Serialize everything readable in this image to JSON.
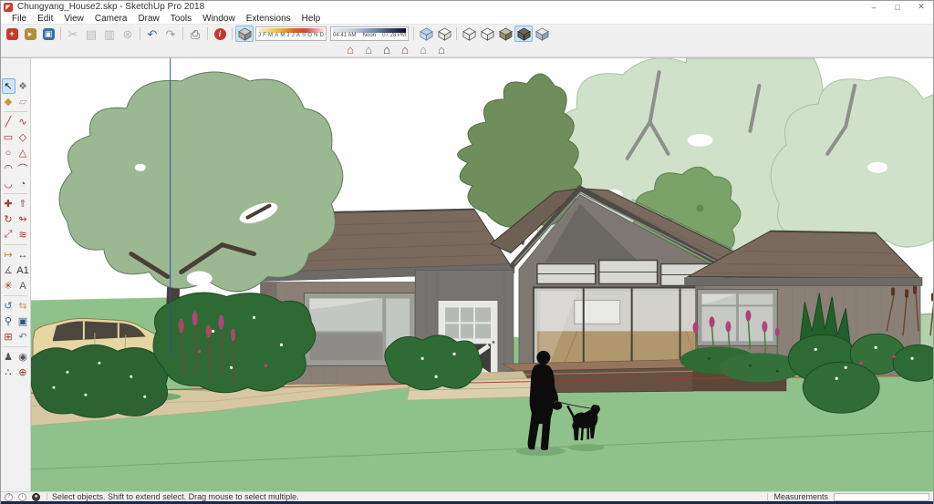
{
  "window": {
    "title": "Chungyang_House2.skp - SketchUp Pro 2018",
    "logo_glyph": "◤",
    "controls": [
      {
        "name": "minimize-button",
        "glyph": "–"
      },
      {
        "name": "maximize-button",
        "glyph": "□"
      },
      {
        "name": "close-button",
        "glyph": "✕"
      }
    ]
  },
  "menu_bar": {
    "items": [
      "File",
      "Edit",
      "View",
      "Camera",
      "Draw",
      "Tools",
      "Window",
      "Extensions",
      "Help"
    ]
  },
  "toolbar": {
    "standard": [
      {
        "name": "new",
        "glyph": "+",
        "chip": "#c23b2e"
      },
      {
        "name": "open",
        "glyph": "▸",
        "chip": "#b08f3e"
      },
      {
        "name": "save",
        "glyph": "▣",
        "chip": "#3a6ea5"
      },
      {
        "sep": true
      },
      {
        "name": "cut",
        "glyph": "✂",
        "disabled": true
      },
      {
        "name": "copy",
        "glyph": "▤",
        "disabled": true
      },
      {
        "name": "paste",
        "glyph": "▥",
        "disabled": true
      },
      {
        "name": "erase",
        "glyph": "⊗",
        "disabled": true
      },
      {
        "sep": true
      },
      {
        "name": "undo",
        "glyph": "↶",
        "color": "#3a6ea5"
      },
      {
        "name": "redo",
        "glyph": "↷",
        "color": "#98a0a8"
      },
      {
        "sep": true
      },
      {
        "name": "print",
        "glyph": "⎙",
        "color": "#555555"
      },
      {
        "sep": true
      },
      {
        "name": "model-info",
        "glyph": "i",
        "chip": "#c23b2e",
        "round": true
      },
      {
        "sep": true
      }
    ],
    "shadow": {
      "toggle_name": "shadows-toggle",
      "months": [
        "J",
        "F",
        "M",
        "A",
        "M",
        "J",
        "J",
        "A",
        "S",
        "O",
        "N",
        "D"
      ],
      "time_start": "04:41 AM",
      "time_mid": "Noon",
      "time_end": "07:28 PM"
    },
    "styles": {
      "buttons": [
        "x-ray",
        "back-edges",
        "wireframe",
        "hidden-line",
        "shaded",
        "shaded-with-textures",
        "monochrome"
      ],
      "active": "shaded-with-textures",
      "group_break_after": "back-edges"
    },
    "views": [
      {
        "name": "iso",
        "glyph": "⌂",
        "color": "#b0502f"
      },
      {
        "name": "top",
        "glyph": "⌂",
        "color": "#6b7c8c"
      },
      {
        "name": "front",
        "glyph": "⌂",
        "color": "#2f3a44"
      },
      {
        "name": "right",
        "glyph": "⌂",
        "color": "#7c4a3a"
      },
      {
        "name": "back",
        "glyph": "⌂",
        "color": "#8a8a8a"
      },
      {
        "name": "left",
        "glyph": "⌂",
        "color": "#5a6b5a"
      }
    ]
  },
  "tool_palette": {
    "active": "select",
    "dividers_after_row": [
      2,
      7,
      10,
      13,
      16
    ],
    "rows": [
      [
        "select",
        "make-component"
      ],
      [
        "paint-bucket",
        "eraser"
      ],
      [
        "line",
        "freehand"
      ],
      [
        "rectangle",
        "rotated-rectangle"
      ],
      [
        "circle",
        "polygon"
      ],
      [
        "arc",
        "2-point-arc"
      ],
      [
        "3-point-arc",
        "pie"
      ],
      [
        "move",
        "push-pull"
      ],
      [
        "rotate",
        "follow-me"
      ],
      [
        "scale",
        "offset"
      ],
      [
        "tape-measure",
        "dimension"
      ],
      [
        "protractor",
        "text"
      ],
      [
        "axes",
        "3d-text"
      ],
      [
        "orbit",
        "pan"
      ],
      [
        "zoom",
        "zoom-window"
      ],
      [
        "zoom-extents",
        "previous-view"
      ],
      [
        "position-camera",
        "look-around"
      ],
      [
        "walk",
        "section-plane"
      ]
    ],
    "icons": {
      "select": "↖",
      "make-component": "❖",
      "paint-bucket": "◆",
      "eraser": "▱",
      "line": "╱",
      "freehand": "∿",
      "rectangle": "▭",
      "rotated-rectangle": "◇",
      "circle": "○",
      "polygon": "△",
      "arc": "◠",
      "2-point-arc": "⌒",
      "3-point-arc": "◡",
      "pie": "◔",
      "move": "✚",
      "push-pull": "⇑",
      "rotate": "↻",
      "follow-me": "↬",
      "scale": "⤢",
      "offset": "≋",
      "tape-measure": "↦",
      "dimension": "↔",
      "protractor": "∡",
      "text": "A1",
      "axes": "✳",
      "3d-text": "A",
      "orbit": "↺",
      "pan": "⇆",
      "zoom": "⚲",
      "zoom-window": "▣",
      "zoom-extents": "⊞",
      "previous-view": "↶",
      "position-camera": "♟",
      "look-around": "◉",
      "walk": "∴",
      "section-plane": "⊕"
    },
    "icon_colors": {
      "select": "#1a1a1a",
      "make-component": "#7d7d7d",
      "paint-bucket": "#c59b2d",
      "eraser": "#cf8ca0",
      "line": "#a33b2e",
      "freehand": "#a33b2e",
      "rectangle": "#a33b2e",
      "rotated-rectangle": "#a33b2e",
      "circle": "#a33b2e",
      "polygon": "#a33b2e",
      "arc": "#a33b2e",
      "2-point-arc": "#a33b2e",
      "3-point-arc": "#a33b2e",
      "pie": "#a33b2e",
      "move": "#a33b2e",
      "push-pull": "#8a5a4a",
      "rotate": "#a33b2e",
      "follow-me": "#a33b2e",
      "scale": "#a33b2e",
      "offset": "#a33b2e",
      "tape-measure": "#b8860b",
      "dimension": "#555555",
      "protractor": "#777777",
      "text": "#333333",
      "axes": "#a33b2e",
      "3d-text": "#555555",
      "orbit": "#3a6ea5",
      "pan": "#c49a6c",
      "zoom": "#345577",
      "zoom-window": "#345577",
      "zoom-extents": "#a33b2e",
      "previous-view": "#6b7f95",
      "position-camera": "#555555",
      "look-around": "#555555",
      "walk": "#222222",
      "section-plane": "#a33b2e"
    }
  },
  "status_bar": {
    "icons": [
      "geolocation-icon",
      "credit-icon",
      "account-icon"
    ],
    "message": "Select objects. Shift to extend select. Drag mouse to select multiple.",
    "measurements_label": "Measurements",
    "measurements_value": ""
  },
  "colors": {
    "toolbar_bg": "#f0f0f0",
    "selection_highlight": "#cde3f7",
    "bottom_border": "#1b2a4a",
    "scene": {
      "sky": "#fefefe",
      "lawn": "#8fc28a",
      "hill": "#b4d1ab",
      "walkway": "#d6c8a3",
      "tree_sage": "#9cb893",
      "tree_pale": "#cfe2c9",
      "tree_olive": "#6f8e5c",
      "tree_medium": "#7aa269",
      "bush_dark": "#2d6332",
      "roof": "#796a5d",
      "siding": "#8a8076",
      "entry_wall": "#777370",
      "glass": "#c5c7c2",
      "door": "#e8e8e5",
      "deck": "#66503f",
      "floor": "#b1976e",
      "car_body": "#e5d6a2",
      "taillight": "#c0392b",
      "silhouette": "#0c0c0c",
      "axis_blue": "#2f4f9e",
      "axis_red": "#a03a2a",
      "flower_magenta": "#ae3f7c"
    }
  }
}
